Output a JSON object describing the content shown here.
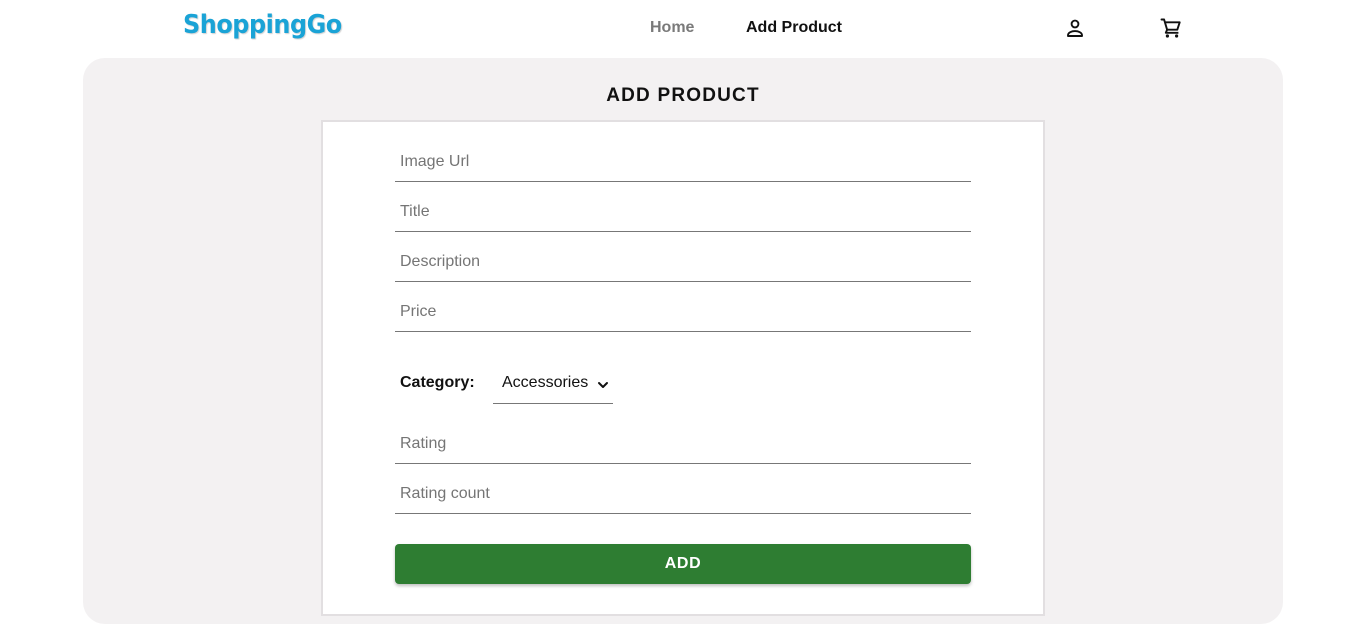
{
  "brand": {
    "name": "ShoppingGo"
  },
  "nav": {
    "home": "Home",
    "add_product": "Add Product",
    "user_icon": "person-outline-icon",
    "cart_icon": "shopping-cart-icon"
  },
  "page": {
    "title": "ADD PRODUCT"
  },
  "form": {
    "image_url_placeholder": "Image Url",
    "title_placeholder": "Title",
    "description_placeholder": "Description",
    "price_placeholder": "Price",
    "category_label": "Category:",
    "category_value": "Accessories",
    "rating_placeholder": "Rating",
    "rating_count_placeholder": "Rating count",
    "submit_label": "ADD"
  },
  "colors": {
    "brand": "#1aa3d6",
    "panel_bg": "#f3f1f2",
    "button_bg": "#2e7d32"
  }
}
